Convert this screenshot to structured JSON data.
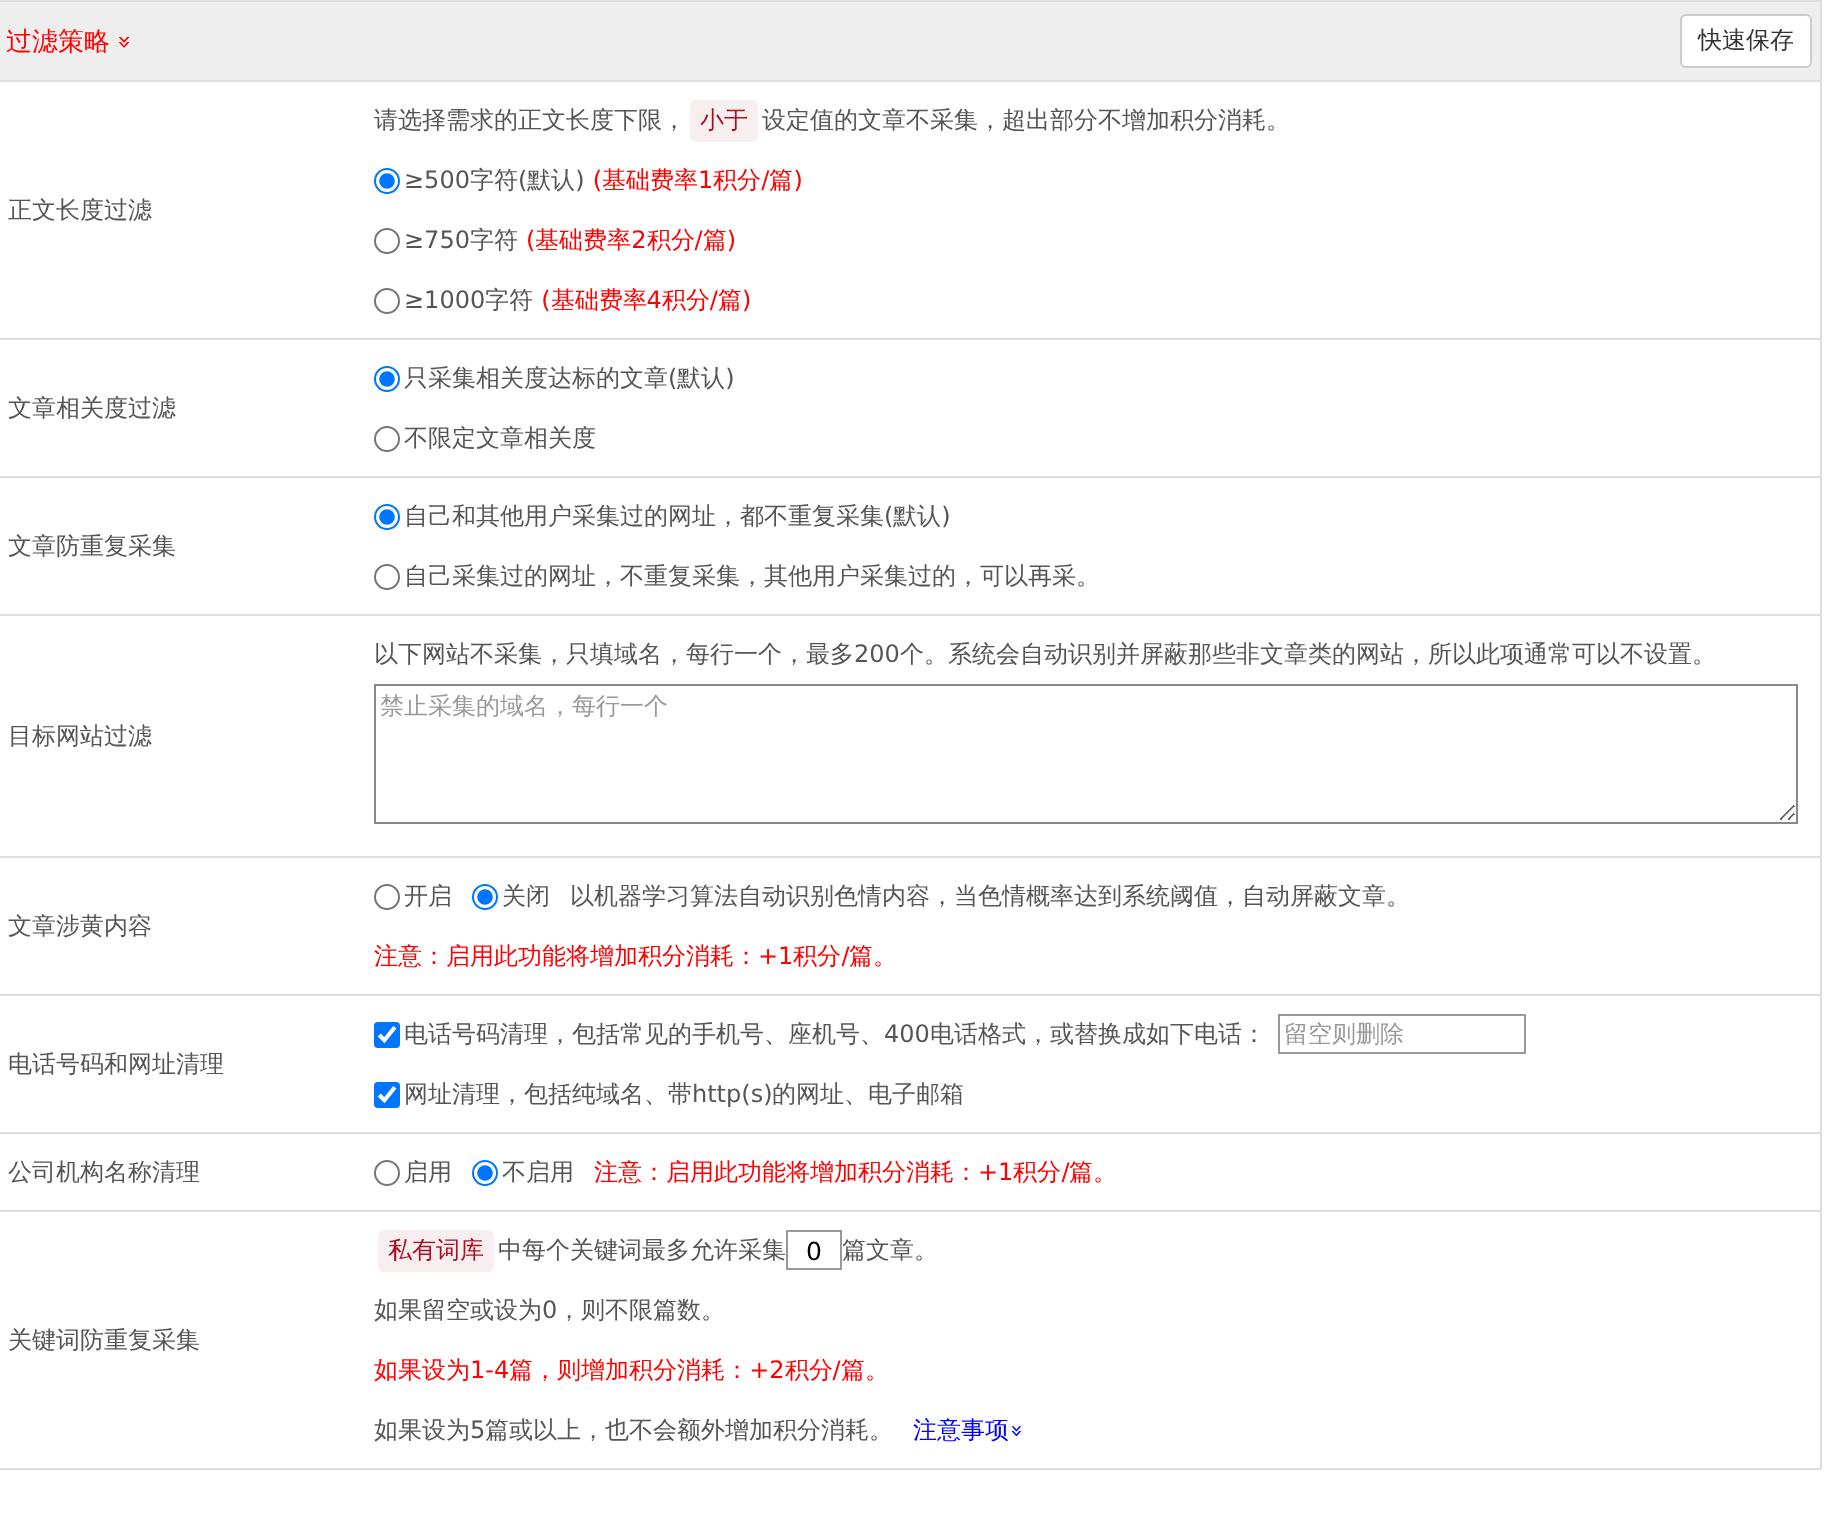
{
  "header": {
    "title": "过滤策略",
    "toggle_icon": "»",
    "save_button": "快速保存"
  },
  "rows": [
    {
      "kind": "radios",
      "label": "正文长度过滤",
      "note": {
        "before": "请选择需求的正文长度下限，",
        "tag": "小于",
        "after": "设定值的文章不采集，超出部分不增加积分消耗。"
      },
      "options": [
        {
          "text": "≥500字符(默认)",
          "extra": "(基础费率1积分/篇)",
          "selected": true
        },
        {
          "text": "≥750字符",
          "extra": "(基础费率2积分/篇)",
          "selected": false
        },
        {
          "text": "≥1000字符",
          "extra": "(基础费率4积分/篇)",
          "selected": false
        }
      ]
    },
    {
      "kind": "radios",
      "label": "文章相关度过滤",
      "options": [
        {
          "text": "只采集相关度达标的文章(默认)",
          "selected": true
        },
        {
          "text": "不限定文章相关度",
          "selected": false
        }
      ]
    },
    {
      "kind": "radios",
      "label": "文章防重复采集",
      "options": [
        {
          "text": "自己和其他用户采集过的网址，都不重复采集(默认)",
          "selected": true
        },
        {
          "text": "自己采集过的网址，不重复采集，其他用户采集过的，可以再采。",
          "selected": false
        }
      ]
    },
    {
      "kind": "textarea",
      "label": "目标网站过滤",
      "text": "以下网站不采集，只填域名，每行一个，最多200个。系统会自动识别并屏蔽那些非文章类的网站，所以此项通常可以不设置。",
      "placeholder": "禁止采集的域名，每行一个"
    },
    {
      "kind": "inline",
      "label": "文章涉黄内容",
      "options": [
        {
          "text": "开启",
          "selected": false
        },
        {
          "text": "关闭",
          "selected": true
        }
      ],
      "text": "以机器学习算法自动识别色情内容，当色情概率达到系统阈值，自动屏蔽文章。",
      "warning": "注意：启用此功能将增加积分消耗：+1积分/篇。"
    },
    {
      "kind": "checks",
      "label": "电话号码和网址清理",
      "options": [
        {
          "text": "电话号码清理，包括常见的手机号、座机号、400电话格式，或替换成如下电话：",
          "checked": true,
          "placeholder": "留空则删除"
        },
        {
          "text": "网址清理，包括纯域名、带http(s)的网址、电子邮箱",
          "checked": true
        }
      ]
    },
    {
      "kind": "inline",
      "label": "公司机构名称清理",
      "options": [
        {
          "text": "启用",
          "selected": false
        },
        {
          "text": "不启用",
          "selected": true
        }
      ],
      "warning": "注意：启用此功能将增加积分消耗：+1积分/篇。"
    },
    {
      "kind": "keyword",
      "label": "关键词防重复采集",
      "tag": "私有词库",
      "before": "中每个关键词最多允许采集",
      "value": "0",
      "after": "篇文章。",
      "lines": [
        {
          "text": "如果留空或设为0，则不限篇数。",
          "kind": "plain"
        },
        {
          "text": "如果设为1-4篇，则增加积分消耗：+2积分/篇。",
          "kind": "warning"
        },
        {
          "text": "如果设为5篇或以上，也不会额外增加积分消耗。",
          "kind": "plain"
        }
      ],
      "link": "注意事项",
      "link_icon": "»"
    }
  ]
}
